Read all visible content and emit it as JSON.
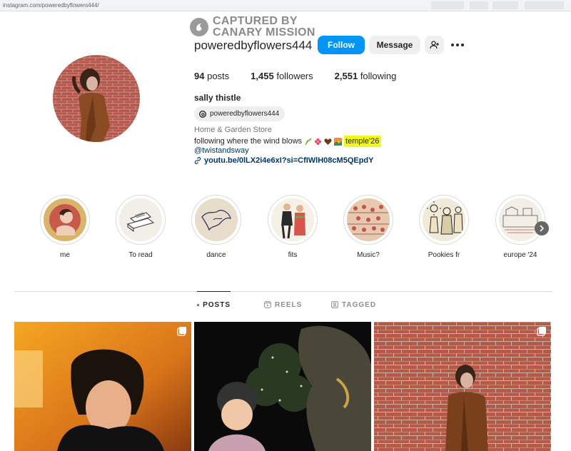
{
  "browser": {
    "url": "instagram.com/poweredbyflowers444/"
  },
  "watermark": {
    "line1": "CAPTURED BY",
    "line2": "CANARY MISSION"
  },
  "profile": {
    "username": "poweredbyflowers444",
    "follow_label": "Follow",
    "message_label": "Message",
    "posts_count": "94",
    "posts_label": "posts",
    "followers_count": "1,455",
    "followers_label": "followers",
    "following_count": "2,551",
    "following_label": "following",
    "full_name": "sally thistle",
    "threads_handle": "poweredbyflowers444",
    "category": "Home & Garden Store",
    "bio_text": "following where the wind blows",
    "bio_highlight": "temple'26",
    "mention": "@twistandsway",
    "link": "youtu.be/0lLX2i4e6xI?si=CfIWlH08cM5QEpdY"
  },
  "highlights": [
    {
      "label": "me"
    },
    {
      "label": "To read"
    },
    {
      "label": "dance"
    },
    {
      "label": "fits"
    },
    {
      "label": "Music?"
    },
    {
      "label": "Pookies fr"
    },
    {
      "label": "europe '24"
    }
  ],
  "tabs": {
    "posts": "POSTS",
    "reels": "REELS",
    "tagged": "TAGGED"
  },
  "colors": {
    "accent": "#0095f6",
    "link": "#00376b",
    "highlight": "#f2f718"
  }
}
